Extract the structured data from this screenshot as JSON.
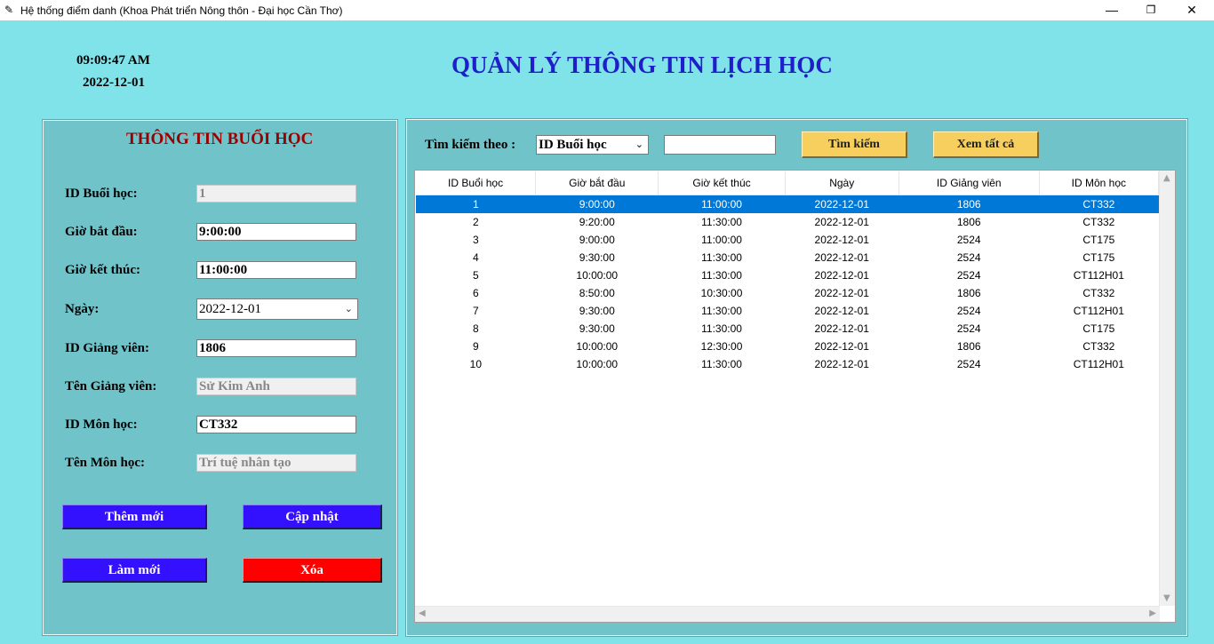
{
  "window": {
    "title": "Hệ thống điểm danh (Khoa Phát triển Nông thôn - Đại học Cần Thơ)",
    "icon": "feather-icon",
    "minimize": "—",
    "restore": "❐",
    "close": "✕"
  },
  "clock": {
    "time": "09:09:47 AM",
    "date": "2022-12-01"
  },
  "page_title": "QUẢN LÝ THÔNG TIN LỊCH HỌC",
  "form": {
    "title": "THÔNG TIN BUỔI HỌC",
    "fields": {
      "id_buoi_hoc": {
        "label": "ID Buổi học:",
        "value": "1"
      },
      "gio_bat_dau": {
        "label": "Giờ bắt đầu:",
        "value": "9:00:00"
      },
      "gio_ket_thuc": {
        "label": "Giờ kết thúc:",
        "value": "11:00:00"
      },
      "ngay": {
        "label": "Ngày:",
        "value": "2022-12-01"
      },
      "id_giang_vien": {
        "label": "ID Giảng viên:",
        "value": "1806"
      },
      "ten_giang_vien": {
        "label": "Tên Giảng viên:",
        "value": "Sử Kim Anh"
      },
      "id_mon_hoc": {
        "label": "ID Môn học:",
        "value": "CT332"
      },
      "ten_mon_hoc": {
        "label": "Tên Môn học:",
        "value": "Trí tuệ nhân tạo"
      }
    },
    "buttons": {
      "add": "Thêm mới",
      "update": "Cập nhật",
      "refresh": "Làm mới",
      "delete": "Xóa"
    }
  },
  "search": {
    "label": "Tìm kiếm theo :",
    "field_selected": "ID Buổi học",
    "query": "",
    "search_button": "Tìm kiếm",
    "view_all_button": "Xem tất cả"
  },
  "table": {
    "columns": [
      "ID Buổi học",
      "Giờ bắt đầu",
      "Giờ kết thúc",
      "Ngày",
      "ID Giảng viên",
      "ID Môn học"
    ],
    "selected_row": 0,
    "rows": [
      [
        "1",
        "9:00:00",
        "11:00:00",
        "2022-12-01",
        "1806",
        "CT332"
      ],
      [
        "2",
        "9:20:00",
        "11:30:00",
        "2022-12-01",
        "1806",
        "CT332"
      ],
      [
        "3",
        "9:00:00",
        "11:00:00",
        "2022-12-01",
        "2524",
        "CT175"
      ],
      [
        "4",
        "9:30:00",
        "11:30:00",
        "2022-12-01",
        "2524",
        "CT175"
      ],
      [
        "5",
        "10:00:00",
        "11:30:00",
        "2022-12-01",
        "2524",
        "CT112H01"
      ],
      [
        "6",
        "8:50:00",
        "10:30:00",
        "2022-12-01",
        "1806",
        "CT332"
      ],
      [
        "7",
        "9:30:00",
        "11:30:00",
        "2022-12-01",
        "2524",
        "CT112H01"
      ],
      [
        "8",
        "9:30:00",
        "11:30:00",
        "2022-12-01",
        "2524",
        "CT175"
      ],
      [
        "9",
        "10:00:00",
        "12:30:00",
        "2022-12-01",
        "1806",
        "CT332"
      ],
      [
        "10",
        "10:00:00",
        "11:30:00",
        "2022-12-01",
        "2524",
        "CT112H01"
      ]
    ]
  },
  "colors": {
    "background": "#80e3ea",
    "panel": "#6fc3c9",
    "title": "#1f1fc8",
    "form_title": "#9b0000",
    "blue_button": "#3311ff",
    "red_button": "#ff0000",
    "yellow_button": "#f7cf5e",
    "selection": "#0078d7"
  }
}
